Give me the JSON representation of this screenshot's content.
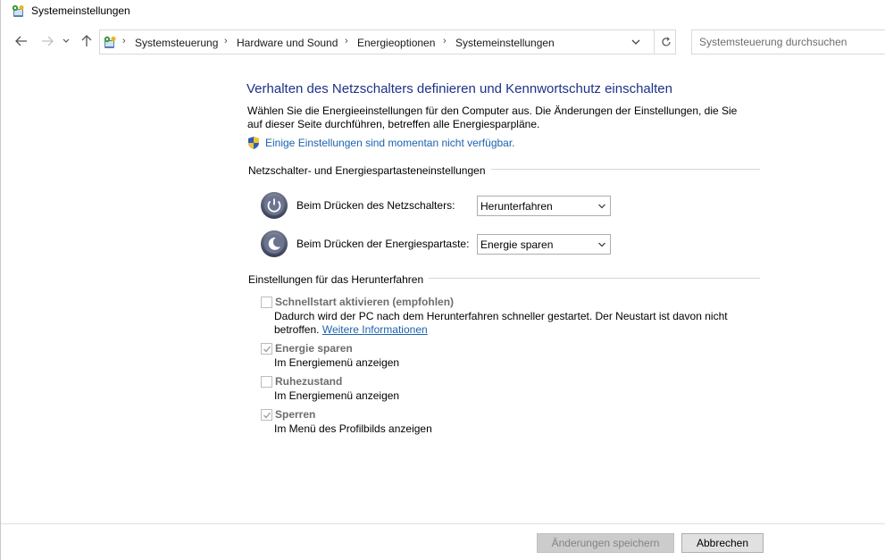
{
  "window": {
    "title": "Systemeinstellungen"
  },
  "address_bar": {
    "breadcrumbs": [
      "Systemsteuerung",
      "Hardware und Sound",
      "Energieoptionen",
      "Systemeinstellungen"
    ],
    "search_placeholder": "Systemsteuerung durchsuchen"
  },
  "page": {
    "heading": "Verhalten des Netzschalters definieren und Kennwortschutz einschalten",
    "description": "Wählen Sie die Energieeinstellungen für den Computer aus. Die Änderungen der Einstellungen, die Sie auf dieser Seite durchführen, betreffen alle Energiesparpläne.",
    "unavailable_link": "Einige Einstellungen sind momentan nicht verfügbar."
  },
  "button_settings": {
    "group_title": "Netzschalter- und Energiespartasteneinstellungen",
    "power_button_label": "Beim Drücken des Netzschalters:",
    "power_button_value": "Herunterfahren",
    "sleep_button_label": "Beim Drücken der Energiespartaste:",
    "sleep_button_value": "Energie sparen"
  },
  "shutdown_settings": {
    "group_title": "Einstellungen für das Herunterfahren",
    "fast_startup": {
      "label": "Schnellstart aktivieren (empfohlen)",
      "checked": false,
      "description": "Dadurch wird der PC nach dem Herunterfahren schneller gestartet. Der Neustart ist davon nicht betroffen.",
      "link": "Weitere Informationen"
    },
    "sleep": {
      "label": "Energie sparen",
      "checked": true,
      "description": "Im Energiemenü anzeigen"
    },
    "hibernate": {
      "label": "Ruhezustand",
      "checked": false,
      "description": "Im Energiemenü anzeigen"
    },
    "lock": {
      "label": "Sperren",
      "checked": true,
      "description": "Im Menü des Profilbilds anzeigen"
    }
  },
  "footer": {
    "save_label": "Änderungen speichern",
    "cancel_label": "Abbrechen"
  },
  "colors": {
    "heading": "#1e3287",
    "link": "#1c62ad",
    "disabled_text": "#6d6d6d"
  }
}
